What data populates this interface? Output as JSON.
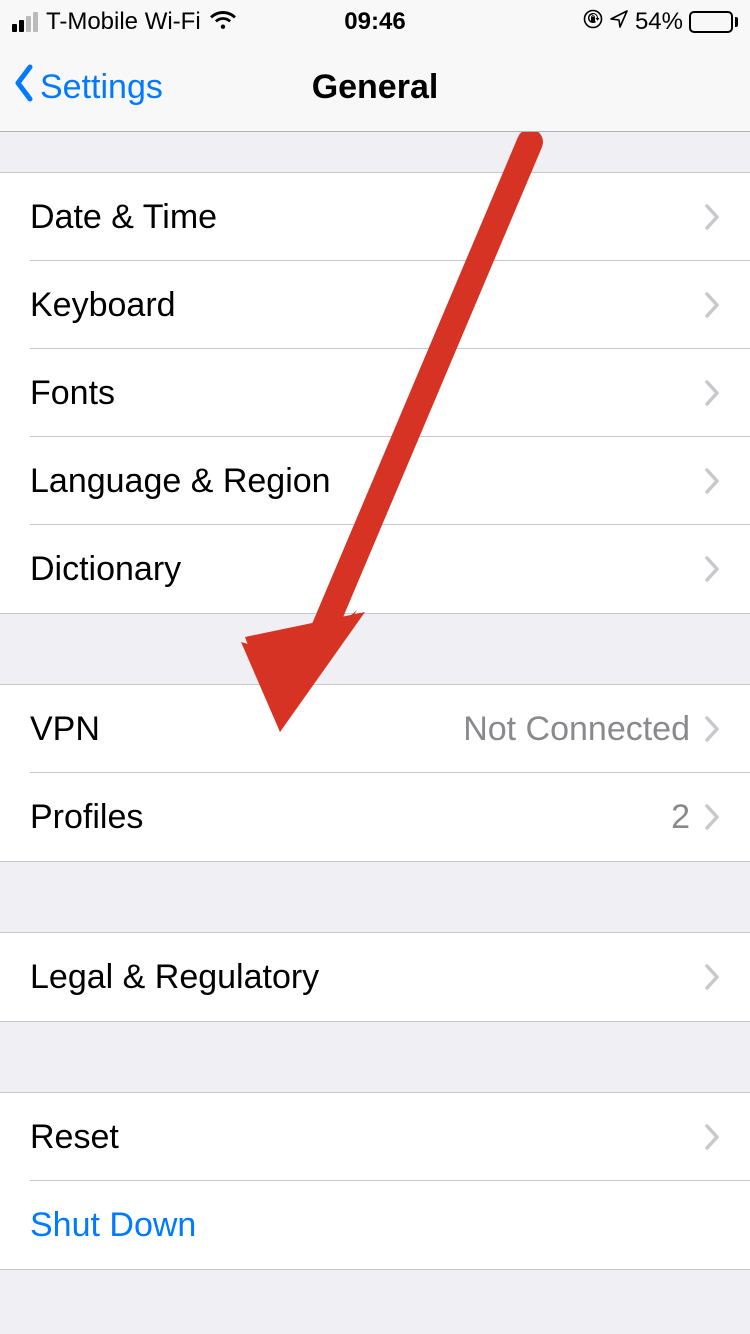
{
  "status": {
    "carrier": "T-Mobile Wi-Fi",
    "time": "09:46",
    "battery_pct": "54%"
  },
  "nav": {
    "back_label": "Settings",
    "title": "General"
  },
  "groups": [
    {
      "rows": [
        {
          "label": "Date & Time",
          "value": "",
          "chevron": true
        },
        {
          "label": "Keyboard",
          "value": "",
          "chevron": true
        },
        {
          "label": "Fonts",
          "value": "",
          "chevron": true
        },
        {
          "label": "Language & Region",
          "value": "",
          "chevron": true
        },
        {
          "label": "Dictionary",
          "value": "",
          "chevron": true
        }
      ]
    },
    {
      "rows": [
        {
          "label": "VPN",
          "value": "Not Connected",
          "chevron": true
        },
        {
          "label": "Profiles",
          "value": "2",
          "chevron": true
        }
      ]
    },
    {
      "rows": [
        {
          "label": "Legal & Regulatory",
          "value": "",
          "chevron": true
        }
      ]
    },
    {
      "rows": [
        {
          "label": "Reset",
          "value": "",
          "chevron": true
        },
        {
          "label": "Shut Down",
          "value": "",
          "chevron": false,
          "link": true
        }
      ]
    }
  ]
}
